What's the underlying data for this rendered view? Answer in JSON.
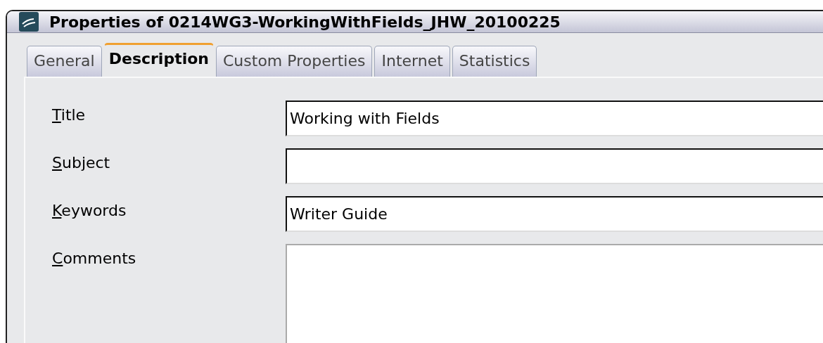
{
  "window": {
    "title": "Properties of 0214WG3-WorkingWithFields_JHW_20100225"
  },
  "tabs": [
    {
      "label": "General",
      "selected": false
    },
    {
      "label": "Description",
      "selected": true
    },
    {
      "label": "Custom Properties",
      "selected": false
    },
    {
      "label": "Internet",
      "selected": false
    },
    {
      "label": "Statistics",
      "selected": false
    }
  ],
  "fields": [
    {
      "label": "Title",
      "value": "Working with Fields",
      "kind": "line"
    },
    {
      "label": "Subject",
      "kind": "line"
    },
    {
      "label": "Keywords",
      "value": "Writer Guide",
      "kind": "line"
    },
    {
      "label": "Comments",
      "kind": "area"
    }
  ]
}
